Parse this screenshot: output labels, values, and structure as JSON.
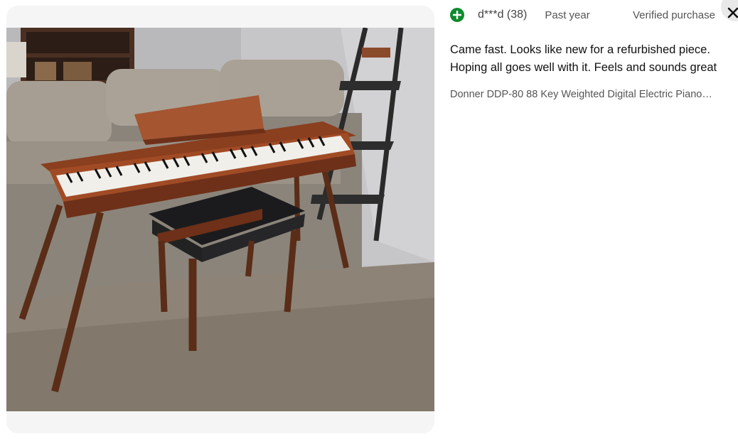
{
  "review": {
    "reviewer": "d***d (38)",
    "time": "Past year",
    "verified": "Verified purchase",
    "text": "Came fast. Looks like new for a refurbished piece. Hoping all goes well with it. Feels and sounds great",
    "product": "Donner DDP-80 88 Key Weighted Digital Electric Piano…"
  },
  "icons": {
    "badge": "plus-circle-icon",
    "close": "close-icon"
  },
  "colors": {
    "badge": "#118a2e",
    "frame": "#f5f5f5",
    "close_bg": "#e9e9e9"
  }
}
